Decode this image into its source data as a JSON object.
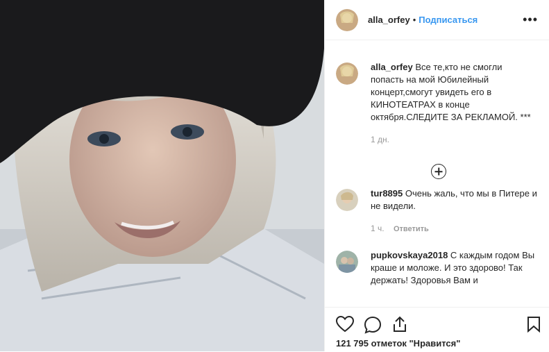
{
  "header": {
    "username": "alla_orfey",
    "separator": "•",
    "follow_label": "Подписаться",
    "more_label": "•••"
  },
  "caption": {
    "username": "alla_orfey",
    "text": "Все те,кто не смогли попасть на мой Юбилейный концерт,смогут увидеть его в КИНОТЕАТРАХ в конце октября.СЛЕДИТЕ ЗА РЕКЛАМОЙ. *** ",
    "time": "1 дн."
  },
  "comments": [
    {
      "username": "tur8895",
      "text": "Очень жаль, что мы в Питере и не видели.",
      "time": "1 ч.",
      "reply_label": "Ответить"
    },
    {
      "username": "pupkovskaya2018",
      "text": "С каждым годом Вы краше и моложе. И это здорово! Так держать! Здоровья Вам и"
    }
  ],
  "likes": {
    "text": "121 795 отметок \"Нравится\""
  },
  "icons": [
    "more-icon",
    "load-more-icon",
    "heart-icon",
    "comment-icon",
    "share-icon",
    "bookmark-icon"
  ],
  "colors": {
    "accent": "#3897f0",
    "text": "#262626",
    "muted": "#999999"
  }
}
